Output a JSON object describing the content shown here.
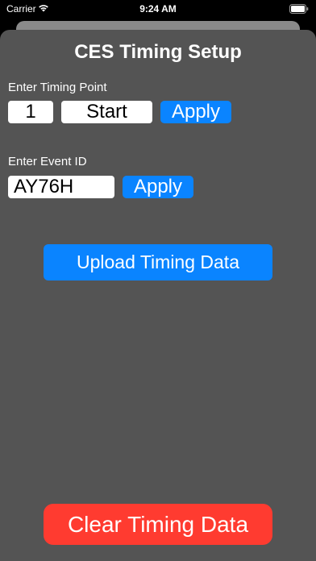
{
  "status_bar": {
    "carrier": "Carrier",
    "time": "9:24 AM",
    "wifi_icon": "wifi-icon",
    "battery_icon": "battery-icon"
  },
  "title": "CES Timing Setup",
  "timing_point": {
    "label": "Enter Timing Point",
    "number_value": "1",
    "name_value": "Start",
    "apply_label": "Apply"
  },
  "event": {
    "label": "Enter Event ID",
    "id_value": "AY76H",
    "apply_label": "Apply"
  },
  "upload_button": "Upload Timing Data",
  "clear_button": "Clear Timing Data",
  "colors": {
    "background": "#545454",
    "accent": "#0a84ff",
    "destructive": "#ff3b30"
  }
}
